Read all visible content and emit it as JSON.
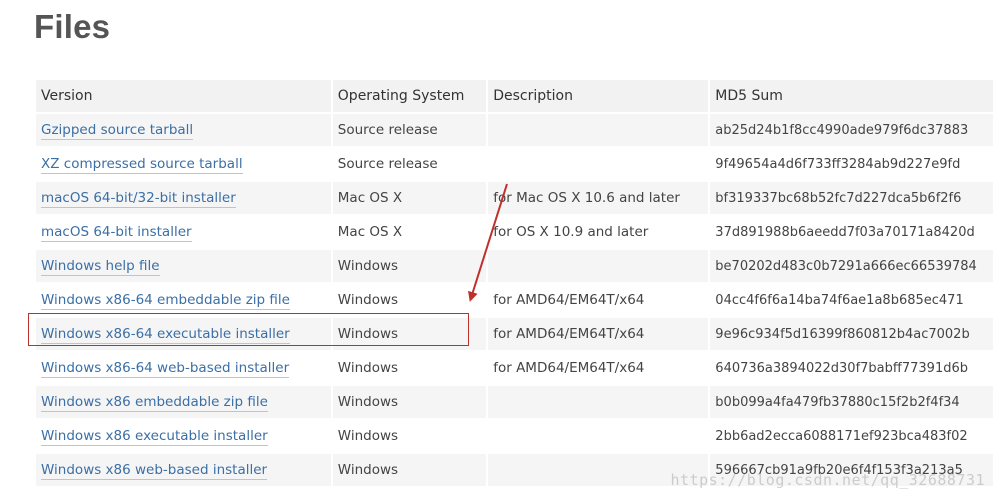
{
  "page": {
    "title": "Files"
  },
  "table": {
    "headers": {
      "version": "Version",
      "os": "Operating System",
      "description": "Description",
      "md5": "MD5 Sum"
    },
    "rows": [
      {
        "version": "Gzipped source tarball",
        "os": "Source release",
        "description": "",
        "md5": "ab25d24b1f8cc4990ade979f6dc37883"
      },
      {
        "version": "XZ compressed source tarball",
        "os": "Source release",
        "description": "",
        "md5": "9f49654a4d6f733ff3284ab9d227e9fd"
      },
      {
        "version": "macOS 64-bit/32-bit installer",
        "os": "Mac OS X",
        "description": "for Mac OS X 10.6 and later",
        "md5": "bf319337bc68b52fc7d227dca5b6f2f6"
      },
      {
        "version": "macOS 64-bit installer",
        "os": "Mac OS X",
        "description": "for OS X 10.9 and later",
        "md5": "37d891988b6aeedd7f03a70171a8420d"
      },
      {
        "version": "Windows help file",
        "os": "Windows",
        "description": "",
        "md5": "be70202d483c0b7291a666ec66539784"
      },
      {
        "version": "Windows x86-64 embeddable zip file",
        "os": "Windows",
        "description": "for AMD64/EM64T/x64",
        "md5": "04cc4f6f6a14ba74f6ae1a8b685ec471"
      },
      {
        "version": "Windows x86-64 executable installer",
        "os": "Windows",
        "description": "for AMD64/EM64T/x64",
        "md5": "9e96c934f5d16399f860812b4ac7002b"
      },
      {
        "version": "Windows x86-64 web-based installer",
        "os": "Windows",
        "description": "for AMD64/EM64T/x64",
        "md5": "640736a3894022d30f7babff77391d6b"
      },
      {
        "version": "Windows x86 embeddable zip file",
        "os": "Windows",
        "description": "",
        "md5": "b0b099a4fa479fb37880c15f2b2f4f34"
      },
      {
        "version": "Windows x86 executable installer",
        "os": "Windows",
        "description": "",
        "md5": "2bb6ad2ecca6088171ef923bca483f02"
      },
      {
        "version": "Windows x86 web-based installer",
        "os": "Windows",
        "description": "",
        "md5": "596667cb91a9fb20e6f4f153f3a213a5"
      }
    ]
  },
  "annotation": {
    "highlight_color": "#c0302b"
  },
  "watermark": {
    "text": "https://blog.csdn.net/qq_32688731"
  }
}
